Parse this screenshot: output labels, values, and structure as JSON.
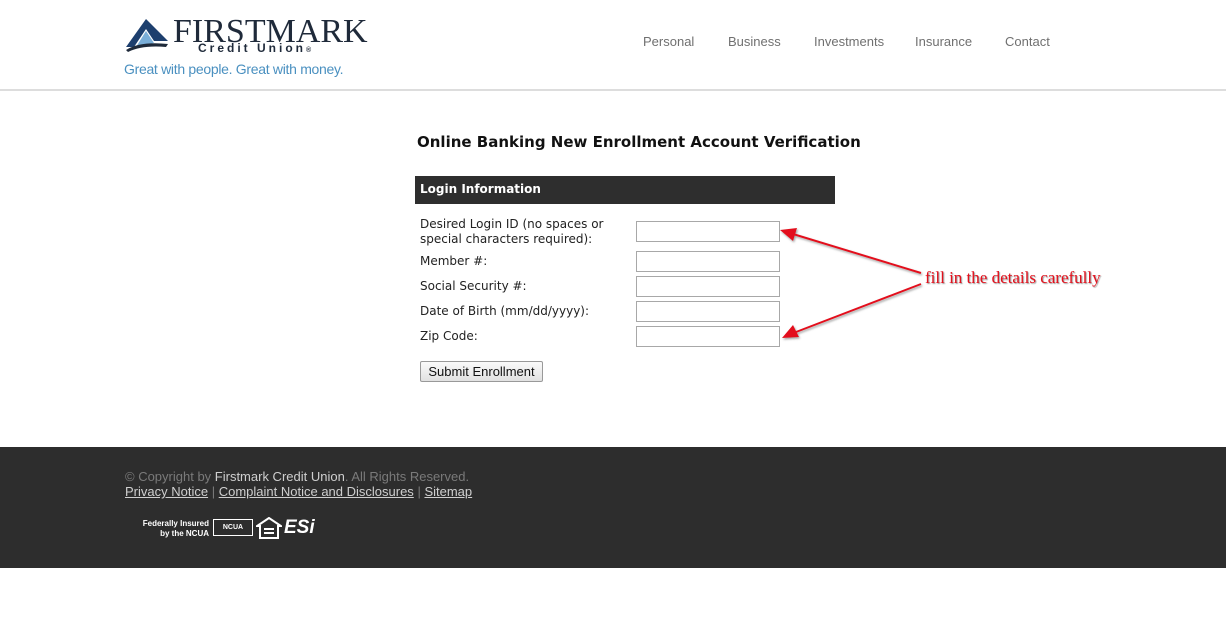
{
  "header": {
    "logo": {
      "name": "FIRSTMARK",
      "sub": "Credit Union",
      "reg": "®",
      "tagline": "Great with people. Great with money."
    },
    "nav": [
      "Personal",
      "Business",
      "Investments",
      "Insurance",
      "Contact"
    ]
  },
  "main": {
    "title": "Online Banking New Enrollment Account Verification",
    "section": "Login Information",
    "fields": [
      {
        "label_line1": "Desired Login ID (no spaces or",
        "label_line2": "special characters required):",
        "value": ""
      },
      {
        "label": "Member #:",
        "value": ""
      },
      {
        "label": "Social Security #:",
        "value": ""
      },
      {
        "label": "Date of Birth (mm/dd/yyyy):",
        "value": ""
      },
      {
        "label": "Zip Code:",
        "value": ""
      }
    ],
    "submit_label": "Submit Enrollment"
  },
  "annotation": {
    "text": "fill in the details carefully",
    "color": "#e3101c"
  },
  "footer": {
    "copyright_prefix": "© Copyright by ",
    "copyright_name": "Firstmark Credit Union",
    "copyright_suffix": ". All Rights Reserved.",
    "links": [
      "Privacy Notice",
      "Complaint Notice and Disclosures",
      "Sitemap"
    ],
    "separator": "|",
    "badges": {
      "fed_line1": "Federally Insured",
      "fed_line2": "by the NCUA",
      "ncua": "NCUA",
      "esi": "ESi"
    }
  },
  "colors": {
    "footer_bg": "#2d2d2d",
    "section_bar": "#2e2e2e",
    "tagline": "#4a90c0",
    "brand_dark": "#1f2a3a"
  }
}
